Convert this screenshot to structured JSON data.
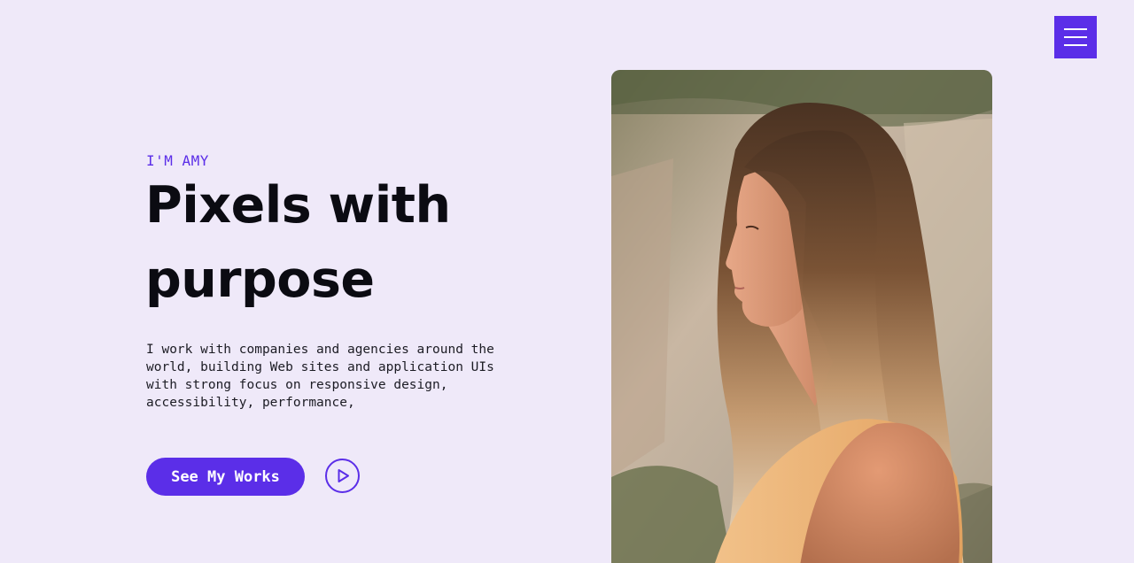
{
  "header": {
    "menu_icon": "hamburger-icon",
    "accent": "#5b2ee8"
  },
  "hero": {
    "eyebrow": "I'M AMY",
    "headline_line1": "Pixels with",
    "headline_line2": "purpose",
    "description": "I work with companies and agencies around the world, building Web sites and application UIs with strong focus on responsive design, accessibility, performance,",
    "cta_label": "See My Works",
    "play_icon": "play-icon",
    "photo_subject": "profile portrait of a woman with long ombre hair"
  },
  "colors": {
    "background": "#efe9f9",
    "primary": "#5b2ee8",
    "text": "#0b0b12"
  }
}
